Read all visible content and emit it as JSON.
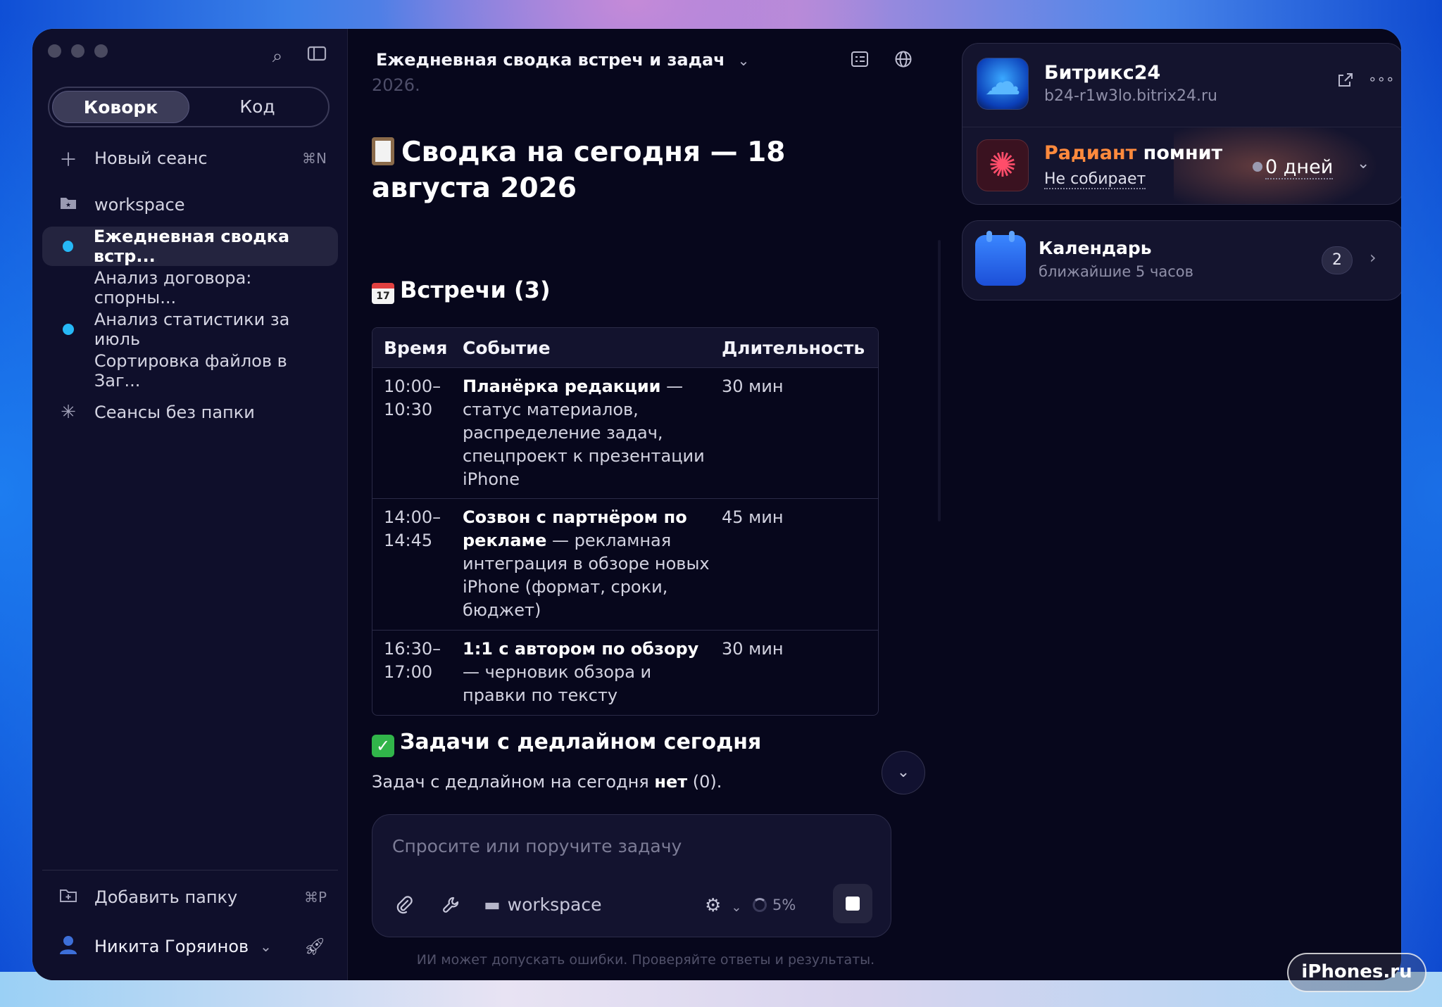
{
  "sidebar": {
    "mode_tabs": [
      "Коворк",
      "Код"
    ],
    "new_session": {
      "label": "Новый сеанс",
      "shortcut": "⌘N"
    },
    "folder": "workspace",
    "sessions": [
      {
        "label": "Ежедневная сводка встр...",
        "dot": true
      },
      {
        "label": "Анализ договора: спорны...",
        "dot": false
      },
      {
        "label": "Анализ статистики за июль",
        "dot": true
      },
      {
        "label": "Сортировка файлов в Заг...",
        "dot": false
      }
    ],
    "no_folder": "Сеансы без папки",
    "add_folder": {
      "label": "Добавить папку",
      "shortcut": "⌘P"
    },
    "user": "Никита Горяинов"
  },
  "main": {
    "title": "Ежедневная сводка встреч и задач",
    "faded_top": "2026.",
    "h1": "Сводка на сегодня — 18 августа 2026",
    "meetings_heading": "Встречи (3)",
    "cal_emoji_day": "17",
    "table": {
      "headers": [
        "Время",
        "Событие",
        "Длительность"
      ],
      "rows": [
        {
          "time": "10:00–\n10:30",
          "event_bold": "Планёрка редакции",
          "event_rest": " — статус материалов, распределение задач, спецпроект к презентации iPhone",
          "duration": "30 мин"
        },
        {
          "time": "14:00–\n14:45",
          "event_bold": "Созвон с партнёром по рекламе",
          "event_rest": " — рекламная интеграция в обзоре новых iPhone (формат, сроки, бюджет)",
          "duration": "45 мин"
        },
        {
          "time": "16:30–\n17:00",
          "event_bold": "1:1 с автором по обзору",
          "event_rest": " — черновик обзора и правки по тексту",
          "duration": "30 мин"
        }
      ]
    },
    "tasks_heading": "Задачи с дедлайном сегодня",
    "tasks_text_pre": "Задач с дедлайном на сегодня ",
    "tasks_text_bold": "нет",
    "tasks_text_post": " (0).",
    "composer": {
      "placeholder": "Спросите или поручите задачу",
      "workspace": "workspace",
      "context_pct": "5%"
    },
    "disclaimer": "ИИ может допускать ошибки. Проверяйте ответы и результаты."
  },
  "right_panel": {
    "bitrix": {
      "title": "Битрикс24",
      "url": "b24-r1w3lo.bitrix24.ru"
    },
    "radiant": {
      "name_accent": "Радиант",
      "name_rest": " помнит",
      "status": "Не собирает",
      "days": "0 дней"
    },
    "calendar": {
      "title": "Календарь",
      "subtitle": "ближайшие 5 часов",
      "count": "2"
    }
  },
  "watermark": "iPhones.ru",
  "colors": {
    "accent_dot": "#26b8f6",
    "radiant_orange": "#ff8a3d",
    "window_bg": "#07071c",
    "sidebar_bg": "#0f0f2b"
  }
}
